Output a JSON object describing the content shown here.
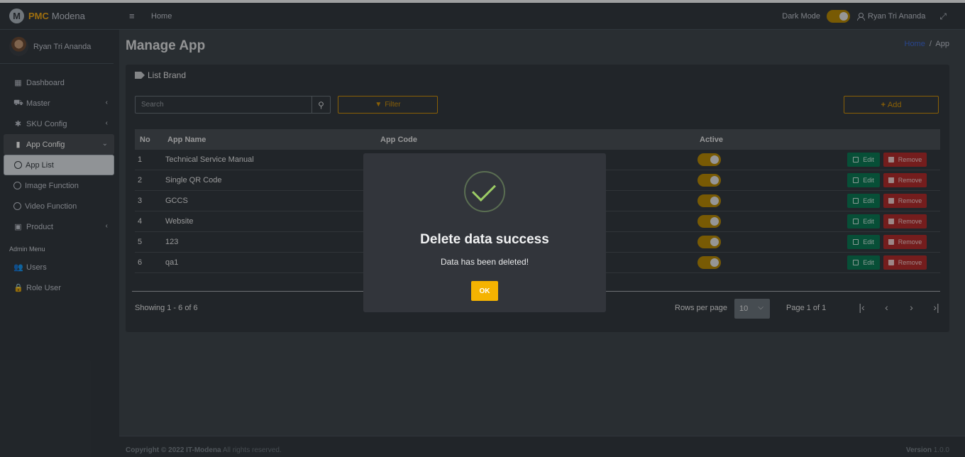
{
  "brand": {
    "logo_letter": "M",
    "name_accent": "PMC",
    "name_rest": "Modena"
  },
  "sidebar": {
    "user_name": "Ryan Tri Ananda",
    "items": [
      {
        "label": "Dashboard",
        "icon": "grid-icon"
      },
      {
        "label": "Master",
        "icon": "car-icon",
        "arrow": "‹"
      },
      {
        "label": "SKU Config",
        "icon": "gear-icon",
        "arrow": "‹"
      },
      {
        "label": "App Config",
        "icon": "mobile-icon",
        "arrow": "⌄"
      },
      {
        "label": "App List",
        "icon": "circle-icon"
      },
      {
        "label": "Image Function",
        "icon": "circle-icon"
      },
      {
        "label": "Video Function",
        "icon": "circle-icon"
      },
      {
        "label": "Product",
        "icon": "briefcase-icon",
        "arrow": "‹"
      }
    ],
    "admin_header": "Admin Menu",
    "admin_items": [
      {
        "label": "Users",
        "icon": "users-icon"
      },
      {
        "label": "Role User",
        "icon": "lock-icon"
      }
    ]
  },
  "topbar": {
    "home": "Home",
    "dark_mode_label": "Dark Mode",
    "user_name": "Ryan Tri Ananda"
  },
  "page": {
    "title": "Manage App",
    "breadcrumb_home": "Home",
    "breadcrumb_sep": "/",
    "breadcrumb_current": "App"
  },
  "card": {
    "title": "List Brand",
    "search_placeholder": "Search",
    "filter_label": "Filter",
    "add_label": "Add"
  },
  "table": {
    "headers": {
      "no": "No",
      "name": "App Name",
      "code": "App Code",
      "active": "Active"
    },
    "rows": [
      {
        "no": "1",
        "name": "Technical Service Manual",
        "code": "",
        "active": true
      },
      {
        "no": "2",
        "name": "Single QR Code",
        "code": "",
        "active": true
      },
      {
        "no": "3",
        "name": "GCCS",
        "code": "",
        "active": true
      },
      {
        "no": "4",
        "name": "Website",
        "code": "",
        "active": true
      },
      {
        "no": "5",
        "name": "123",
        "code": "",
        "active": true
      },
      {
        "no": "6",
        "name": "qa1",
        "code": "",
        "active": true
      }
    ],
    "edit_label": "Edit",
    "remove_label": "Remove"
  },
  "pagination": {
    "showing": "Showing 1 - 6 of 6",
    "rows_per_page_label": "Rows per page",
    "rows_per_page": "10",
    "page_info": "Page 1 of 1"
  },
  "footer": {
    "copyright_prefix": "Copyright © 2022",
    "company": "IT-Modena",
    "rights": "All rights reserved.",
    "version_label": "Version",
    "version": "1.0.0"
  },
  "modal": {
    "title": "Delete data success",
    "message": "Data has been deleted!",
    "ok_label": "OK"
  },
  "colors": {
    "accent": "#d4940a",
    "success": "#9ccc65",
    "edit": "#0b7a55",
    "remove": "#b22d2d",
    "ok": "#f5b301"
  }
}
